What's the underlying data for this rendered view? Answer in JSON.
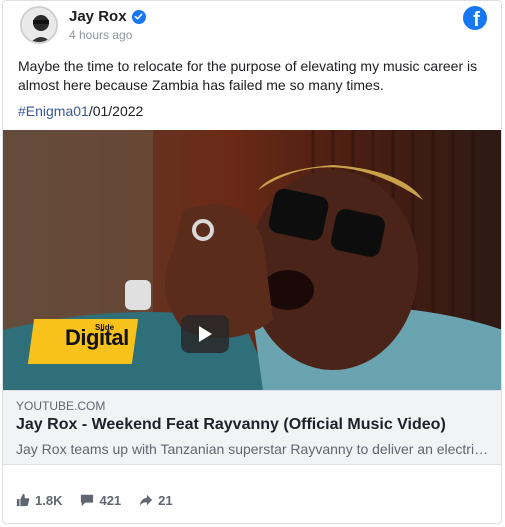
{
  "post": {
    "author": "Jay Rox",
    "time": "4 hours ago",
    "text": "Maybe the time to relocate for the purpose of elevating my music career is almost here because Zambia has failed me so many times.",
    "hashtag": "#Enigma01",
    "hashtag_suffix": "/01/2022"
  },
  "media": {
    "watermark_small": "Slide",
    "watermark_main": "Digital"
  },
  "link_preview": {
    "domain": "YOUTUBE.COM",
    "title": "Jay Rox - Weekend Feat Rayvanny (Official Music Video)",
    "description": "Jay Rox teams up with Tanzanian superstar Rayvanny to deliver an electrifying performance in the video for Weekend"
  },
  "stats": {
    "likes": "1.8K",
    "comments": "421",
    "shares": "21"
  },
  "colors": {
    "facebook_blue": "#1877f2",
    "hashtag": "#385898",
    "watermark_yellow": "#f7c21c"
  },
  "icons": [
    "verified-icon",
    "facebook-icon",
    "play-icon",
    "like-icon",
    "comment-icon",
    "share-icon"
  ]
}
